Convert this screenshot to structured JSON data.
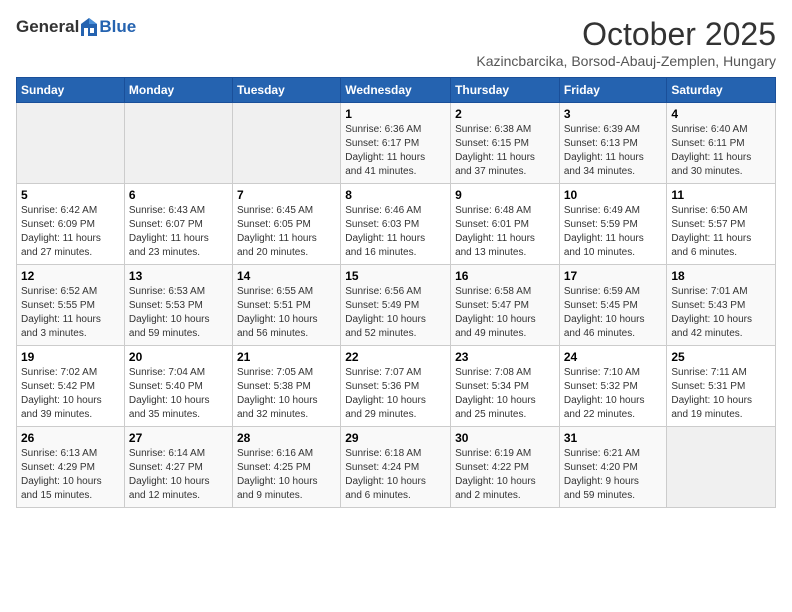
{
  "header": {
    "logo_general": "General",
    "logo_blue": "Blue",
    "month": "October 2025",
    "location": "Kazincbarcika, Borsod-Abauj-Zemplen, Hungary"
  },
  "weekdays": [
    "Sunday",
    "Monday",
    "Tuesday",
    "Wednesday",
    "Thursday",
    "Friday",
    "Saturday"
  ],
  "weeks": [
    [
      {
        "day": "",
        "info": ""
      },
      {
        "day": "",
        "info": ""
      },
      {
        "day": "",
        "info": ""
      },
      {
        "day": "1",
        "info": "Sunrise: 6:36 AM\nSunset: 6:17 PM\nDaylight: 11 hours\nand 41 minutes."
      },
      {
        "day": "2",
        "info": "Sunrise: 6:38 AM\nSunset: 6:15 PM\nDaylight: 11 hours\nand 37 minutes."
      },
      {
        "day": "3",
        "info": "Sunrise: 6:39 AM\nSunset: 6:13 PM\nDaylight: 11 hours\nand 34 minutes."
      },
      {
        "day": "4",
        "info": "Sunrise: 6:40 AM\nSunset: 6:11 PM\nDaylight: 11 hours\nand 30 minutes."
      }
    ],
    [
      {
        "day": "5",
        "info": "Sunrise: 6:42 AM\nSunset: 6:09 PM\nDaylight: 11 hours\nand 27 minutes."
      },
      {
        "day": "6",
        "info": "Sunrise: 6:43 AM\nSunset: 6:07 PM\nDaylight: 11 hours\nand 23 minutes."
      },
      {
        "day": "7",
        "info": "Sunrise: 6:45 AM\nSunset: 6:05 PM\nDaylight: 11 hours\nand 20 minutes."
      },
      {
        "day": "8",
        "info": "Sunrise: 6:46 AM\nSunset: 6:03 PM\nDaylight: 11 hours\nand 16 minutes."
      },
      {
        "day": "9",
        "info": "Sunrise: 6:48 AM\nSunset: 6:01 PM\nDaylight: 11 hours\nand 13 minutes."
      },
      {
        "day": "10",
        "info": "Sunrise: 6:49 AM\nSunset: 5:59 PM\nDaylight: 11 hours\nand 10 minutes."
      },
      {
        "day": "11",
        "info": "Sunrise: 6:50 AM\nSunset: 5:57 PM\nDaylight: 11 hours\nand 6 minutes."
      }
    ],
    [
      {
        "day": "12",
        "info": "Sunrise: 6:52 AM\nSunset: 5:55 PM\nDaylight: 11 hours\nand 3 minutes."
      },
      {
        "day": "13",
        "info": "Sunrise: 6:53 AM\nSunset: 5:53 PM\nDaylight: 10 hours\nand 59 minutes."
      },
      {
        "day": "14",
        "info": "Sunrise: 6:55 AM\nSunset: 5:51 PM\nDaylight: 10 hours\nand 56 minutes."
      },
      {
        "day": "15",
        "info": "Sunrise: 6:56 AM\nSunset: 5:49 PM\nDaylight: 10 hours\nand 52 minutes."
      },
      {
        "day": "16",
        "info": "Sunrise: 6:58 AM\nSunset: 5:47 PM\nDaylight: 10 hours\nand 49 minutes."
      },
      {
        "day": "17",
        "info": "Sunrise: 6:59 AM\nSunset: 5:45 PM\nDaylight: 10 hours\nand 46 minutes."
      },
      {
        "day": "18",
        "info": "Sunrise: 7:01 AM\nSunset: 5:43 PM\nDaylight: 10 hours\nand 42 minutes."
      }
    ],
    [
      {
        "day": "19",
        "info": "Sunrise: 7:02 AM\nSunset: 5:42 PM\nDaylight: 10 hours\nand 39 minutes."
      },
      {
        "day": "20",
        "info": "Sunrise: 7:04 AM\nSunset: 5:40 PM\nDaylight: 10 hours\nand 35 minutes."
      },
      {
        "day": "21",
        "info": "Sunrise: 7:05 AM\nSunset: 5:38 PM\nDaylight: 10 hours\nand 32 minutes."
      },
      {
        "day": "22",
        "info": "Sunrise: 7:07 AM\nSunset: 5:36 PM\nDaylight: 10 hours\nand 29 minutes."
      },
      {
        "day": "23",
        "info": "Sunrise: 7:08 AM\nSunset: 5:34 PM\nDaylight: 10 hours\nand 25 minutes."
      },
      {
        "day": "24",
        "info": "Sunrise: 7:10 AM\nSunset: 5:32 PM\nDaylight: 10 hours\nand 22 minutes."
      },
      {
        "day": "25",
        "info": "Sunrise: 7:11 AM\nSunset: 5:31 PM\nDaylight: 10 hours\nand 19 minutes."
      }
    ],
    [
      {
        "day": "26",
        "info": "Sunrise: 6:13 AM\nSunset: 4:29 PM\nDaylight: 10 hours\nand 15 minutes."
      },
      {
        "day": "27",
        "info": "Sunrise: 6:14 AM\nSunset: 4:27 PM\nDaylight: 10 hours\nand 12 minutes."
      },
      {
        "day": "28",
        "info": "Sunrise: 6:16 AM\nSunset: 4:25 PM\nDaylight: 10 hours\nand 9 minutes."
      },
      {
        "day": "29",
        "info": "Sunrise: 6:18 AM\nSunset: 4:24 PM\nDaylight: 10 hours\nand 6 minutes."
      },
      {
        "day": "30",
        "info": "Sunrise: 6:19 AM\nSunset: 4:22 PM\nDaylight: 10 hours\nand 2 minutes."
      },
      {
        "day": "31",
        "info": "Sunrise: 6:21 AM\nSunset: 4:20 PM\nDaylight: 9 hours\nand 59 minutes."
      },
      {
        "day": "",
        "info": ""
      }
    ]
  ]
}
